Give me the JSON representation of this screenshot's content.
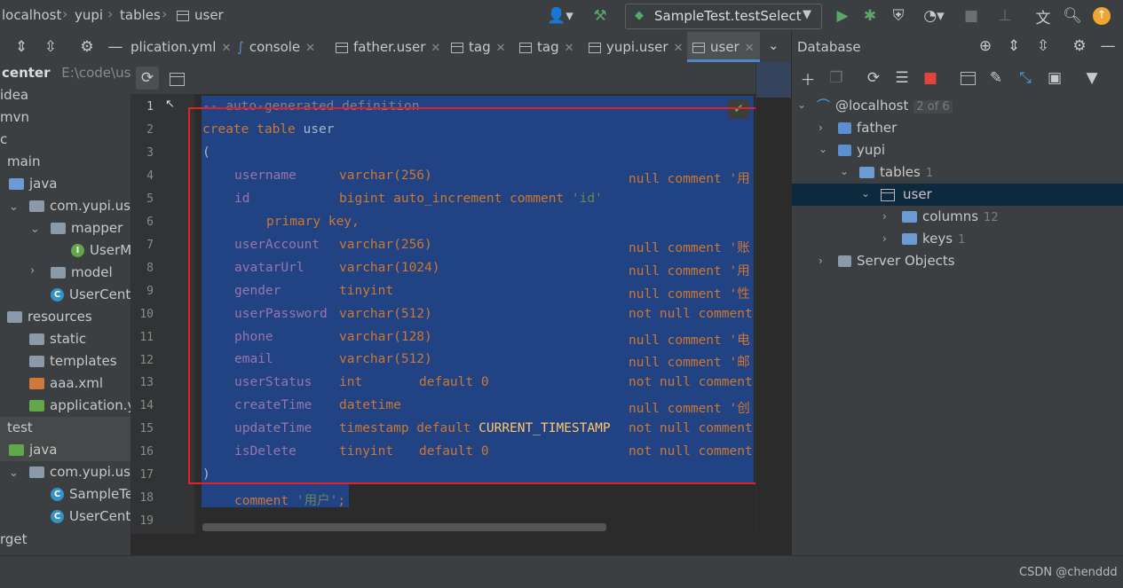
{
  "breadcrumb": {
    "items": [
      "localhost",
      "yupi",
      "tables",
      "user"
    ]
  },
  "run_config": {
    "label": "SampleTest.testSelect"
  },
  "colors": {
    "selection": "#214283",
    "annotation": "#e0212b",
    "accent": "#4a88c7",
    "run": "#59a869"
  },
  "tabs": [
    {
      "label": "plication.yml",
      "active": false
    },
    {
      "label": "console",
      "active": false
    },
    {
      "label": "father.user",
      "active": false
    },
    {
      "label": "tag",
      "active": false
    },
    {
      "label": "tag",
      "active": false
    },
    {
      "label": "yupi.user",
      "active": false
    },
    {
      "label": "user",
      "active": true
    }
  ],
  "project": {
    "root_label": "center",
    "root_path": "E:\\code\\user-",
    "items": [
      "idea",
      "mvn",
      "c",
      "main",
      "java",
      "com.yupi.use",
      "mapper",
      "UserM",
      "model",
      "UserCente",
      "resources",
      "static",
      "templates",
      "aaa.xml",
      "application.y",
      "test",
      "java",
      "com.yupi.use",
      "SampleTe",
      "UserCente",
      "rget"
    ]
  },
  "editor": {
    "line_numbers": [
      "1",
      "2",
      "3",
      "4",
      "5",
      "6",
      "7",
      "8",
      "9",
      "10",
      "11",
      "12",
      "13",
      "14",
      "15",
      "16",
      "17",
      "18",
      "19"
    ],
    "lines": {
      "l1": "-- auto-generated definition",
      "l2a": "create table ",
      "l2b": "user",
      "l3": "(",
      "l4": {
        "name": "username",
        "type": "varchar(256)",
        "tail": "null comment '用"
      },
      "l5": {
        "name": "id",
        "type": "bigint auto_increment comment ",
        "tail": "'id'"
      },
      "l6": "primary key,",
      "l7": {
        "name": "userAccount",
        "type": "varchar(256)",
        "tail": "null comment '账"
      },
      "l8": {
        "name": "avatarUrl",
        "type": "varchar(1024)",
        "tail": "null comment '用"
      },
      "l9": {
        "name": "gender",
        "type": "tinyint",
        "tail": "null comment '性"
      },
      "l10": {
        "name": "userPassword",
        "type": "varchar(512)",
        "tail": "not null comment"
      },
      "l11": {
        "name": "phone",
        "type": "varchar(128)",
        "tail": "null comment '电"
      },
      "l12": {
        "name": "email",
        "type": "varchar(512)",
        "tail": "null comment '邮"
      },
      "l13": {
        "name": "userStatus",
        "type": "int",
        "mid": "default 0",
        "tail": "not null comment"
      },
      "l14": {
        "name": "createTime",
        "type": "datetime",
        "tail": "null comment '创"
      },
      "l15": {
        "name": "updateTime",
        "type": "timestamp default ",
        "fn": "CURRENT_TIMESTAMP",
        "tail": "not null comment"
      },
      "l16": {
        "name": "isDelete",
        "type": "tinyint",
        "mid": "default 0",
        "tail": "not null comment"
      },
      "l17": ")",
      "l18a": "comment ",
      "l18b": "'用户'",
      "l18c": ";"
    }
  },
  "database": {
    "title": "Database",
    "host": {
      "label": "@localhost",
      "count": "2 of 6"
    },
    "schemas": [
      {
        "label": "father"
      },
      {
        "label": "yupi"
      }
    ],
    "tables": {
      "label": "tables",
      "count": "1"
    },
    "table_user": {
      "label": "user"
    },
    "columns": {
      "label": "columns",
      "count": "12"
    },
    "keys": {
      "label": "keys",
      "count": "1"
    },
    "server_objects": {
      "label": "Server Objects"
    }
  },
  "watermark": "CSDN @chenddd"
}
